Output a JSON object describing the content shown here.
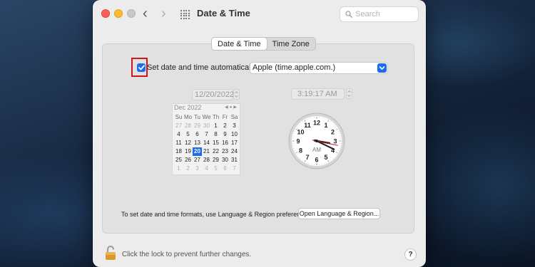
{
  "window": {
    "title": "Date & Time"
  },
  "search": {
    "placeholder": "Search"
  },
  "tabs": [
    {
      "label": "Date & Time",
      "active": true
    },
    {
      "label": "Time Zone",
      "active": false
    }
  ],
  "auto": {
    "checked": true,
    "label": "Set date and time automatically:",
    "server": "Apple (time.apple.com.)"
  },
  "date_field": {
    "value": "12/20/2022"
  },
  "time_field": {
    "value": "3:19:17 AM"
  },
  "calendar": {
    "month_label": "Dec 2022",
    "weekdays": [
      "Su",
      "Mo",
      "Tu",
      "We",
      "Th",
      "Fr",
      "Sa"
    ],
    "weeks": [
      [
        "27",
        "28",
        "29",
        "30",
        "1",
        "2",
        "3"
      ],
      [
        "4",
        "5",
        "6",
        "7",
        "8",
        "9",
        "10"
      ],
      [
        "11",
        "12",
        "13",
        "14",
        "15",
        "16",
        "17"
      ],
      [
        "18",
        "19",
        "20",
        "21",
        "22",
        "23",
        "24"
      ],
      [
        "25",
        "26",
        "27",
        "28",
        "29",
        "30",
        "31"
      ],
      [
        "1",
        "2",
        "3",
        "4",
        "5",
        "6",
        "7"
      ]
    ],
    "selected": "20"
  },
  "clock": {
    "numbers": [
      "12",
      "1",
      "2",
      "3",
      "4",
      "5",
      "6",
      "7",
      "8",
      "9",
      "10",
      "11"
    ],
    "ampm": "AM",
    "hour": 3,
    "minute": 19,
    "second": 17
  },
  "footer": {
    "text": "To set date and time formats, use Language & Region preferences.",
    "button": "Open Language & Region..."
  },
  "lock": {
    "text": "Click the lock to prevent further changes."
  },
  "help": {
    "label": "?"
  },
  "colors": {
    "accent": "#1a6cf0",
    "highlight_box": "#d0161c",
    "second_hand": "#c9122a"
  }
}
